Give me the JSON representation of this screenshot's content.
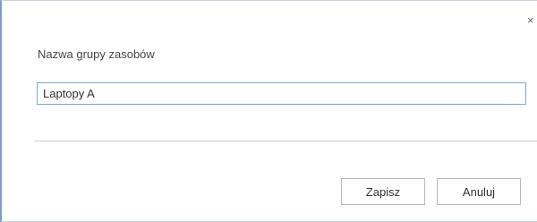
{
  "dialog": {
    "close_glyph": "×",
    "field_label": "Nazwa grupy zasobów",
    "field_value": "Laptopy A",
    "save_label": "Zapisz",
    "cancel_label": "Anuluj"
  },
  "colors": {
    "input_border": "#7aa7d8",
    "dialog_left_border": "#7a9cc6"
  },
  "icons": {
    "close": "close-icon"
  }
}
